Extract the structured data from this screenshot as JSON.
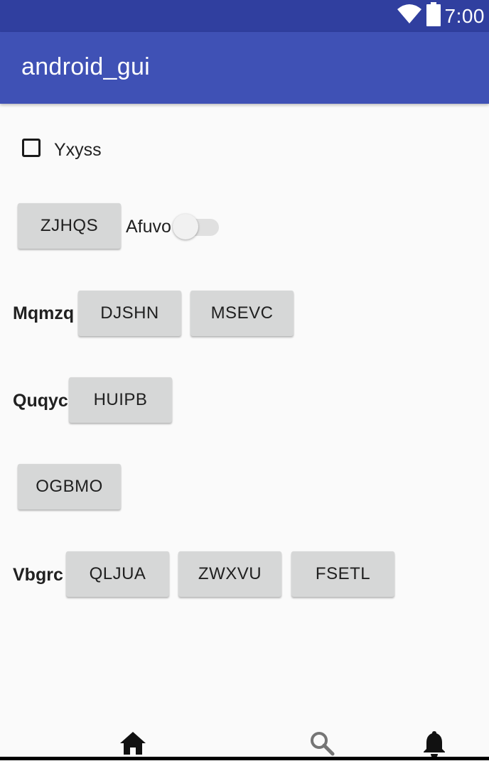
{
  "status_bar": {
    "time": "7:00",
    "icons": [
      "wifi-icon",
      "battery-icon"
    ]
  },
  "app_bar": {
    "title": "android_gui"
  },
  "checkbox": {
    "label": "Yxyss",
    "checked": false
  },
  "row1": {
    "button": "ZJHQS",
    "switch_label": "Afuvo",
    "switch_on": false
  },
  "row2": {
    "label": "Mqmzq",
    "buttons": [
      "DJSHN",
      "MSEVC"
    ]
  },
  "row3": {
    "label": "Quqyc",
    "button": "HUIPB"
  },
  "row4": {
    "button": "OGBMO"
  },
  "row5": {
    "label": "Vbgrc",
    "buttons": [
      "QLJUA",
      "ZWXVU",
      "FSETL"
    ]
  },
  "bottom_nav": {
    "icons": [
      "home-icon",
      "search-icon",
      "bell-icon"
    ]
  },
  "colors": {
    "status_bar": "#303f9f",
    "app_bar": "#3f51b5",
    "background": "#fafafa",
    "button": "#d6d7d7"
  }
}
